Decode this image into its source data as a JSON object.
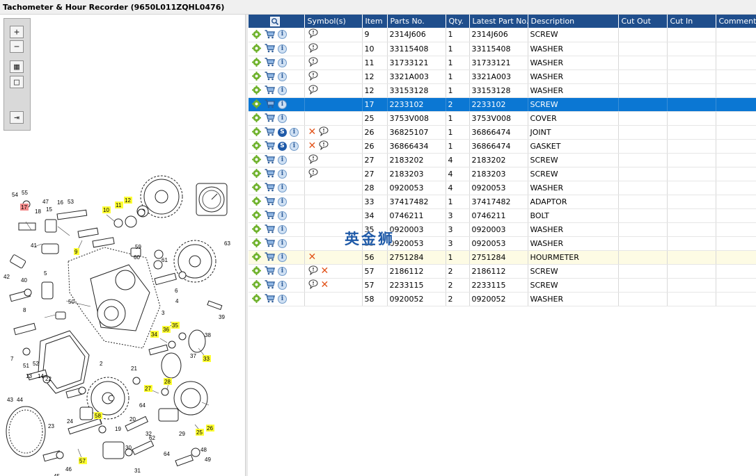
{
  "window": {
    "title": "Tachometer & Hour Recorder (9650L011ZQHL0476)"
  },
  "toolbar": {
    "buttons": [
      {
        "name": "zoom-in",
        "glyph": "+"
      },
      {
        "name": "zoom-out",
        "glyph": "−"
      },
      {
        "name": "fit-all",
        "glyph": "▦"
      },
      {
        "name": "fit-window",
        "glyph": "□"
      },
      {
        "name": "export",
        "glyph": "⇥"
      }
    ]
  },
  "table": {
    "columns": [
      "Symbol(s)",
      "Item",
      "Parts No.",
      "Qty.",
      "Latest Part No.",
      "Description",
      "Cut Out",
      "Cut In",
      "Comment"
    ],
    "rows": [
      {
        "icons": [
          "gear",
          "cart",
          "info"
        ],
        "symbols": [
          "comment"
        ],
        "item": "9",
        "part": "2314J606",
        "qty": "1",
        "latest": "2314J606",
        "desc": "SCREW"
      },
      {
        "icons": [
          "gear",
          "cart",
          "info"
        ],
        "symbols": [
          "comment"
        ],
        "item": "10",
        "part": "33115408",
        "qty": "1",
        "latest": "33115408",
        "desc": "WASHER"
      },
      {
        "icons": [
          "gear",
          "cart",
          "info"
        ],
        "symbols": [
          "comment"
        ],
        "item": "11",
        "part": "31733121",
        "qty": "1",
        "latest": "31733121",
        "desc": "WASHER"
      },
      {
        "icons": [
          "gear",
          "cart",
          "info"
        ],
        "symbols": [
          "comment"
        ],
        "item": "12",
        "part": "3321A003",
        "qty": "1",
        "latest": "3321A003",
        "desc": "WASHER"
      },
      {
        "icons": [
          "gear",
          "cart",
          "info"
        ],
        "symbols": [
          "comment"
        ],
        "item": "12",
        "part": "33153128",
        "qty": "1",
        "latest": "33153128",
        "desc": "WASHER"
      },
      {
        "icons": [
          "gear",
          "cart",
          "info"
        ],
        "symbols": [],
        "item": "17",
        "part": "2233102",
        "qty": "2",
        "latest": "2233102",
        "desc": "SCREW",
        "state": "selected"
      },
      {
        "icons": [
          "gear",
          "cart",
          "info"
        ],
        "symbols": [],
        "item": "25",
        "part": "3753V008",
        "qty": "1",
        "latest": "3753V008",
        "desc": "COVER"
      },
      {
        "icons": [
          "gear",
          "cart",
          "s",
          "info"
        ],
        "symbols": [
          "cross",
          "comment"
        ],
        "item": "26",
        "part": "36825107",
        "qty": "1",
        "latest": "36866474",
        "desc": "JOINT"
      },
      {
        "icons": [
          "gear",
          "cart",
          "s",
          "info"
        ],
        "symbols": [
          "cross",
          "comment"
        ],
        "item": "26",
        "part": "36866434",
        "qty": "1",
        "latest": "36866474",
        "desc": "GASKET"
      },
      {
        "icons": [
          "gear",
          "cart",
          "info"
        ],
        "symbols": [
          "comment"
        ],
        "item": "27",
        "part": "2183202",
        "qty": "4",
        "latest": "2183202",
        "desc": "SCREW"
      },
      {
        "icons": [
          "gear",
          "cart",
          "info"
        ],
        "symbols": [
          "comment"
        ],
        "item": "27",
        "part": "2183203",
        "qty": "4",
        "latest": "2183203",
        "desc": "SCREW"
      },
      {
        "icons": [
          "gear",
          "cart",
          "info"
        ],
        "symbols": [],
        "item": "28",
        "part": "0920053",
        "qty": "4",
        "latest": "0920053",
        "desc": "WASHER"
      },
      {
        "icons": [
          "gear",
          "cart",
          "info"
        ],
        "symbols": [],
        "item": "33",
        "part": "37417482",
        "qty": "1",
        "latest": "37417482",
        "desc": "ADAPTOR"
      },
      {
        "icons": [
          "gear",
          "cart",
          "info"
        ],
        "symbols": [],
        "item": "34",
        "part": "0746211",
        "qty": "3",
        "latest": "0746211",
        "desc": "BOLT"
      },
      {
        "icons": [
          "gear",
          "cart",
          "info"
        ],
        "symbols": [],
        "item": "35",
        "part": "0920003",
        "qty": "3",
        "latest": "0920003",
        "desc": "WASHER"
      },
      {
        "icons": [
          "gear",
          "cart",
          "info"
        ],
        "symbols": [],
        "item": "35",
        "part": "0920053",
        "qty": "3",
        "latest": "0920053",
        "desc": "WASHER"
      },
      {
        "icons": [
          "gear",
          "cart",
          "info"
        ],
        "symbols": [
          "cross"
        ],
        "item": "56",
        "part": "2751284",
        "qty": "1",
        "latest": "2751284",
        "desc": "HOURMETER",
        "state": "highlighted"
      },
      {
        "icons": [
          "gear",
          "cart",
          "info"
        ],
        "symbols": [
          "comment",
          "cross"
        ],
        "item": "57",
        "part": "2186112",
        "qty": "2",
        "latest": "2186112",
        "desc": "SCREW"
      },
      {
        "icons": [
          "gear",
          "cart",
          "info"
        ],
        "symbols": [
          "comment",
          "cross"
        ],
        "item": "57",
        "part": "2233115",
        "qty": "2",
        "latest": "2233115",
        "desc": "SCREW"
      },
      {
        "icons": [
          "gear",
          "cart",
          "info"
        ],
        "symbols": [],
        "item": "58",
        "part": "0920052",
        "qty": "2",
        "latest": "0920052",
        "desc": "WASHER"
      }
    ]
  },
  "watermark": {
    "text": "英金狮"
  },
  "diagram": {
    "callouts_plain": [
      "54",
      "55",
      "47",
      "18",
      "15",
      "16",
      "53",
      "41",
      "59",
      "60",
      "61",
      "63",
      "42",
      "50",
      "5",
      "40",
      "4",
      "3",
      "1",
      "39",
      "8",
      "7",
      "2",
      "38",
      "37",
      "51",
      "52",
      "13",
      "14",
      "22",
      "21",
      "43",
      "44",
      "23",
      "24",
      "20",
      "19",
      "64",
      "62",
      "30",
      "29",
      "32",
      "31",
      "45",
      "46",
      "48",
      "49",
      "6"
    ],
    "callouts_yellow": [
      "10",
      "11",
      "12",
      "9",
      "34",
      "36",
      "35",
      "33",
      "28",
      "27",
      "58",
      "57",
      "25",
      "26"
    ],
    "callouts_red": [
      "17"
    ]
  },
  "colors": {
    "header_bg": "#1f4e8c",
    "selected_row": "#0b77d3",
    "highlight_row": "#fdfbe4",
    "callout_yellow": "#ffff33",
    "callout_red": "#f28a8a"
  }
}
